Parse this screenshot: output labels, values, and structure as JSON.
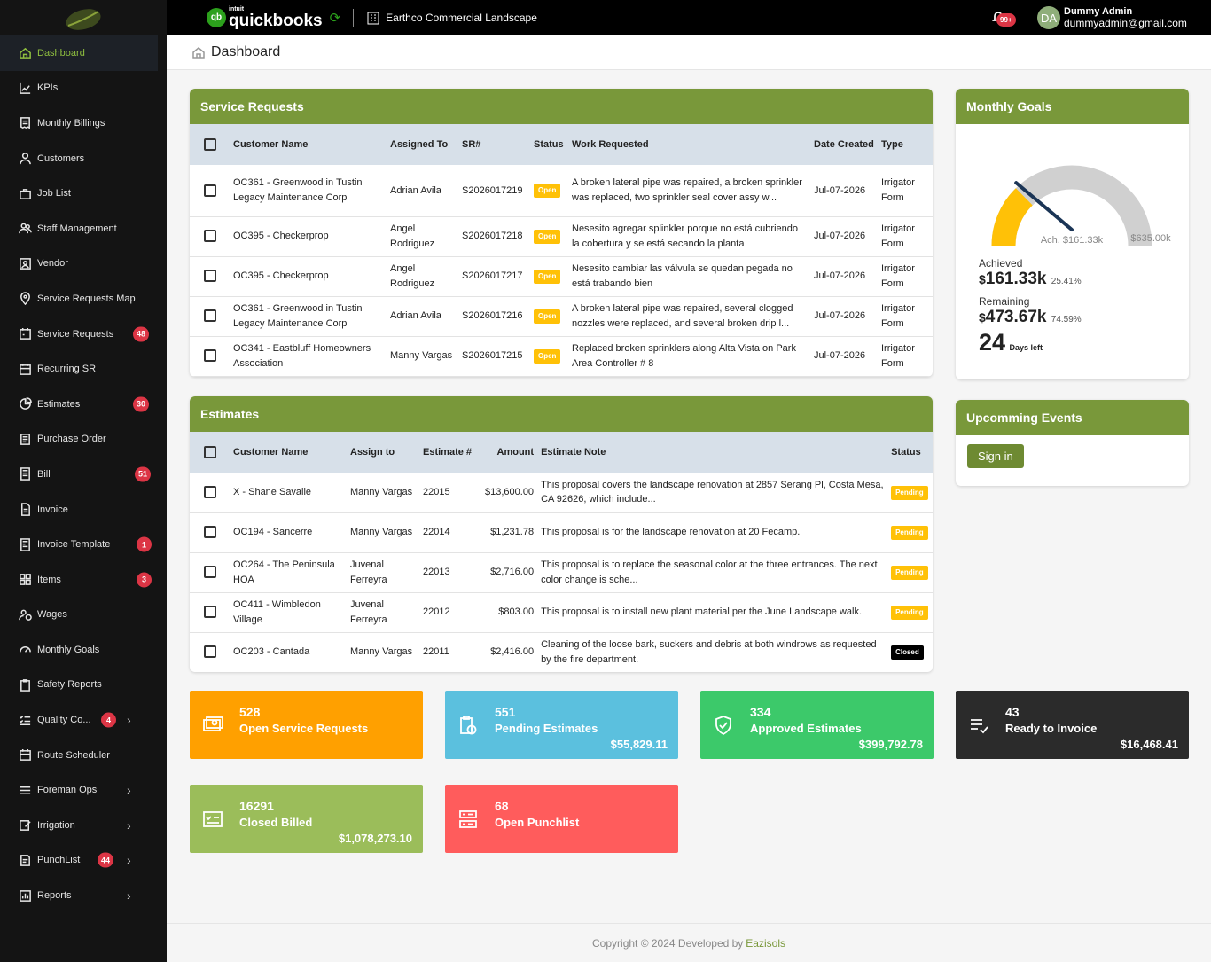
{
  "sidebar": {
    "items": [
      {
        "label": "Dashboard",
        "icon": "home-icon"
      },
      {
        "label": "KPIs",
        "icon": "chart-icon"
      },
      {
        "label": "Monthly Billings",
        "icon": "receipt-icon"
      },
      {
        "label": "Customers",
        "icon": "user-icon"
      },
      {
        "label": "Job List",
        "icon": "briefcase-icon"
      },
      {
        "label": "Staff Management",
        "icon": "users-icon"
      },
      {
        "label": "Vendor",
        "icon": "vendor-icon"
      },
      {
        "label": "Service Requests Map",
        "icon": "map-pin-icon"
      },
      {
        "label": "Service Requests",
        "icon": "tool-icon",
        "badge": "48"
      },
      {
        "label": "Recurring SR",
        "icon": "calendar-icon"
      },
      {
        "label": "Estimates",
        "icon": "pie-icon",
        "badge": "30"
      },
      {
        "label": "Purchase Order",
        "icon": "document-icon"
      },
      {
        "label": "Bill",
        "icon": "bill-icon",
        "badge": "51"
      },
      {
        "label": "Invoice",
        "icon": "invoice-icon"
      },
      {
        "label": "Invoice Template",
        "icon": "template-icon",
        "badge": "1"
      },
      {
        "label": "Items",
        "icon": "grid-icon",
        "badge": "3"
      },
      {
        "label": "Wages",
        "icon": "wages-icon"
      },
      {
        "label": "Monthly Goals",
        "icon": "gauge-icon"
      },
      {
        "label": "Safety Reports",
        "icon": "clipboard-icon"
      },
      {
        "label": "Quality Co...",
        "icon": "checklist-icon",
        "badge": "4",
        "chevron": true
      },
      {
        "label": "Route Scheduler",
        "icon": "calendar-icon"
      },
      {
        "label": "Foreman Ops",
        "icon": "menu-icon",
        "chevron": true
      },
      {
        "label": "Irrigation",
        "icon": "edit-icon",
        "chevron": true
      },
      {
        "label": "PunchList",
        "icon": "punch-icon",
        "badge": "44",
        "chevron": true
      },
      {
        "label": "Reports",
        "icon": "report-icon",
        "chevron": true
      }
    ]
  },
  "topbar": {
    "qb_small": "intuit",
    "qb_brand": "quickbooks",
    "qb_logo": "qb",
    "company": "Earthco Commercial Landscape",
    "notif": "99+",
    "avatar": "DA",
    "user_name": "Dummy Admin",
    "user_email": "dummyadmin@gmail.com"
  },
  "page": {
    "title": "Dashboard"
  },
  "sr": {
    "title": "Service Requests",
    "headers": [
      "Customer Name",
      "Assigned To",
      "SR#",
      "Status",
      "Work Requested",
      "Date Created",
      "Type"
    ],
    "rows": [
      {
        "customer": "OC361 - Greenwood in Tustin Legacy Maintenance Corp",
        "assigned": "Adrian Avila",
        "sr": "S2026017219",
        "status": "Open",
        "work": "A broken lateral pipe was repaired, a broken sprinkler was replaced, two sprinkler seal cover assy w...",
        "date": "Jul-07-2026",
        "type": "Irrigator Form"
      },
      {
        "customer": "OC395 - Checkerprop",
        "assigned": "Angel Rodriguez",
        "sr": "S2026017218",
        "status": "Open",
        "work": "Nesesito agregar splinkler porque no está cubriendo la cobertura y se está secando la planta",
        "date": "Jul-07-2026",
        "type": "Irrigator Form"
      },
      {
        "customer": "OC395 - Checkerprop",
        "assigned": "Angel Rodriguez",
        "sr": "S2026017217",
        "status": "Open",
        "work": "Nesesito cambiar las válvula se quedan pegada no está trabando bien",
        "date": "Jul-07-2026",
        "type": "Irrigator Form"
      },
      {
        "customer": "OC361 - Greenwood in Tustin Legacy Maintenance Corp",
        "assigned": "Adrian Avila",
        "sr": "S2026017216",
        "status": "Open",
        "work": "A broken lateral pipe was repaired, several clogged nozzles were replaced, and several broken drip l...",
        "date": "Jul-07-2026",
        "type": "Irrigator Form"
      },
      {
        "customer": "OC341 - Eastbluff Homeowners Association",
        "assigned": "Manny Vargas",
        "sr": "S2026017215",
        "status": "Open",
        "work": "Replaced broken sprinklers along Alta Vista on Park Area Controller # 8",
        "date": "Jul-07-2026",
        "type": "Irrigator Form"
      }
    ]
  },
  "est": {
    "title": "Estimates",
    "headers": [
      "Customer Name",
      "Assign to",
      "Estimate #",
      "Amount",
      "Estimate Note",
      "Status"
    ],
    "rows": [
      {
        "customer": "X - Shane Savalle",
        "assign": "Manny Vargas",
        "num": "22015",
        "amount": "$13,600.00",
        "note": "This proposal covers the landscape renovation at 2857 Serang Pl, Costa Mesa, CA 92626, which include...",
        "status": "Pending"
      },
      {
        "customer": "OC194 - Sancerre",
        "assign": "Manny Vargas",
        "num": "22014",
        "amount": "$1,231.78",
        "note": "This proposal is for the landscape renovation at 20 Fecamp.",
        "status": "Pending"
      },
      {
        "customer": "OC264 - The Peninsula HOA",
        "assign": "Juvenal Ferreyra",
        "num": "22013",
        "amount": "$2,716.00",
        "note": "This proposal is to replace the seasonal color at the three entrances. The next color change is sche...",
        "status": "Pending"
      },
      {
        "customer": "OC411 - Wimbledon Village",
        "assign": "Juvenal Ferreyra",
        "num": "22012",
        "amount": "$803.00",
        "note": "This proposal is to install new plant material per the June Landscape walk.",
        "status": "Pending"
      },
      {
        "customer": "OC203 - Cantada",
        "assign": "Manny Vargas",
        "num": "22011",
        "amount": "$2,416.00",
        "note": "Cleaning of the loose bark, suckers and debris at both windrows as requested by the fire department.",
        "status": "Closed"
      }
    ]
  },
  "goals": {
    "title": "Monthly Goals",
    "gauge_fraction": 0.2541,
    "gauge_ach_label": "Ach. $161.33k",
    "gauge_max_label": "$635.00k",
    "achieved_label": "Achieved",
    "achieved_value": "161.33k",
    "achieved_pct": "25.41%",
    "remaining_label": "Remaining",
    "remaining_value": "473.67k",
    "remaining_pct": "74.59%",
    "currency": "$",
    "days": "24",
    "days_label": "Days left"
  },
  "events": {
    "title": "Upcomming Events",
    "signin": "Sign in"
  },
  "tiles": [
    {
      "num": "528",
      "label": "Open Service Requests",
      "amount": "",
      "color": "#ffa000",
      "icon": "money-icon"
    },
    {
      "num": "551",
      "label": "Pending Estimates",
      "amount": "$55,829.11",
      "color": "#5bc0de",
      "icon": "clipboard-clock-icon"
    },
    {
      "num": "334",
      "label": "Approved Estimates",
      "amount": "$399,792.78",
      "color": "#3cc96a",
      "icon": "shield-check-icon"
    },
    {
      "num": "43",
      "label": "Ready to Invoice",
      "amount": "$16,468.41",
      "color": "#2b2b2b",
      "icon": "list-check-icon"
    },
    {
      "num": "16291",
      "label": "Closed Billed",
      "amount": "$1,078,273.10",
      "color": "#9bbd5a",
      "icon": "checklist-box-icon"
    },
    {
      "num": "68",
      "label": "Open Punchlist",
      "amount": "",
      "color": "#ff5c5c",
      "icon": "server-icon"
    }
  ],
  "footer": {
    "text": "Copyright © 2024 Developed by",
    "brand": "Eazisols"
  },
  "colors": {
    "accent": "#79983a",
    "sidebar": "#141414",
    "gauge_fill": "#ffc107",
    "gauge_track": "#d0d0d0",
    "needle": "#1b3556"
  }
}
